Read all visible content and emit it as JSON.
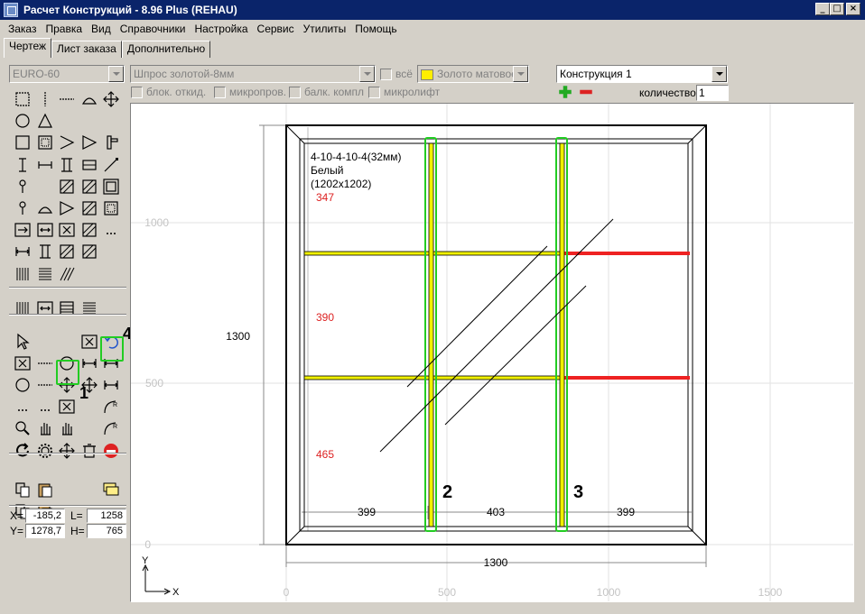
{
  "window": {
    "title": "Расчет Конструкций - 8.96 Plus (REHAU)",
    "minimize": "_",
    "maximize": "□",
    "close": "×"
  },
  "menu": [
    {
      "label": "Заказ"
    },
    {
      "label": "Правка"
    },
    {
      "label": "Вид"
    },
    {
      "label": "Справочники"
    },
    {
      "label": "Настройка"
    },
    {
      "label": "Сервис"
    },
    {
      "label": "Утилиты"
    },
    {
      "label": "Помощь"
    }
  ],
  "tabs": [
    "Чертеж",
    "Лист заказа",
    "Дополнительно"
  ],
  "toolbar": {
    "profile_system": "EURO-60",
    "shpros": "Шпрос золотой-8мм",
    "all_label": "всё",
    "color_label": "Золото матовое",
    "color_swatch": "#ffee00",
    "construction": "Конструкция 1",
    "quantity_label": "количество",
    "quantity_value": "1",
    "add_icon": "plus-icon",
    "remove_icon": "minus-icon",
    "options": [
      {
        "label": "блок. откид."
      },
      {
        "label": "микропров."
      },
      {
        "label": "балк. компл"
      },
      {
        "label": "микролифт"
      }
    ]
  },
  "tool_labels": {
    "t1": "1",
    "t4": "4"
  },
  "coords": {
    "x_label": "X=",
    "x_value": "-185,2",
    "y_label": "Y=",
    "y_value": "1278,7",
    "l_label": "L=",
    "l_value": "1258",
    "h_label": "H=",
    "h_value": "765"
  },
  "drawing": {
    "glass_formula": "4-10-4-10-4(32мм)",
    "color": "Белый",
    "size": "(1202x1202)",
    "heights": [
      "347",
      "390",
      "465"
    ],
    "widths": [
      "399",
      "403",
      "399"
    ],
    "overall_height": "1300",
    "overall_width": "1300",
    "callouts": [
      "2",
      "3"
    ],
    "x_ticks": [
      "0",
      "500",
      "1000",
      "1500"
    ],
    "y_ticks": [
      "1000",
      "500",
      "0"
    ],
    "axis_x": "X",
    "axis_y": "Y",
    "accent_green": "#22cc22",
    "accent_red": "#ee2222",
    "bar_yellow": "#f0f000"
  }
}
